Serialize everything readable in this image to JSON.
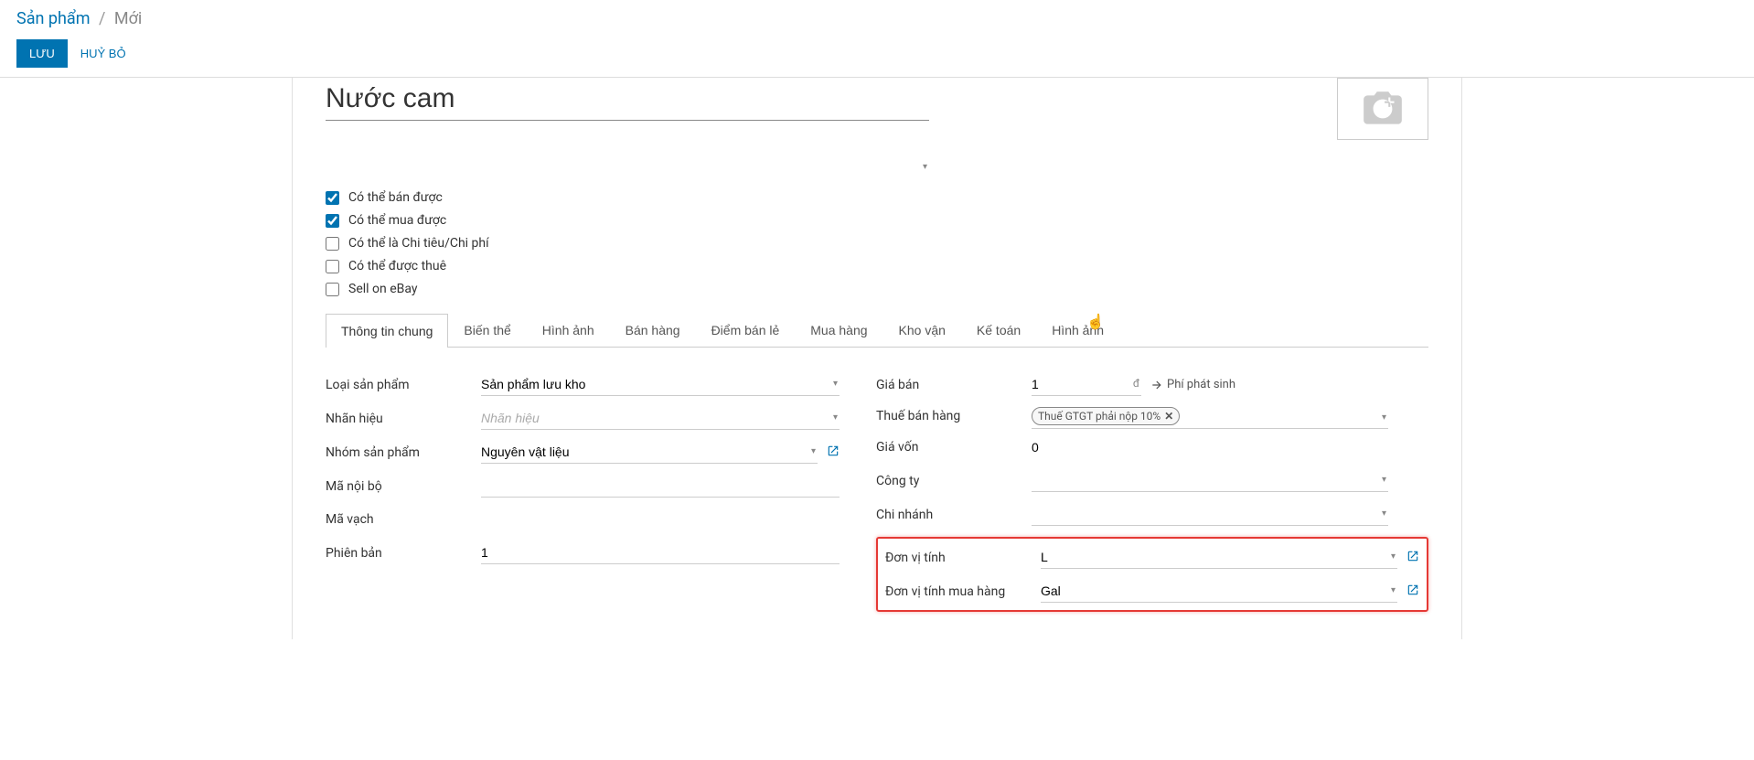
{
  "breadcrumb": {
    "root": "Sản phẩm",
    "current": "Mới"
  },
  "actions": {
    "save": "LƯU",
    "discard": "HUỶ BỎ"
  },
  "product": {
    "name": "Nước cam"
  },
  "checks": {
    "can_sell": "Có thể bán được",
    "can_buy": "Có thể mua được",
    "is_expense": "Có thể là Chi tiêu/Chi phí",
    "can_rent": "Có thể được thuê",
    "sell_ebay": "Sell on eBay"
  },
  "tabs": [
    "Thông tin chung",
    "Biến thể",
    "Hình ảnh",
    "Bán hàng",
    "Điểm bán lẻ",
    "Mua hàng",
    "Kho vận",
    "Kế toán",
    "Hình ảnh"
  ],
  "left": {
    "product_type_label": "Loại sản phẩm",
    "product_type_value": "Sản phẩm lưu kho",
    "brand_label": "Nhãn hiệu",
    "brand_placeholder": "Nhãn hiệu",
    "category_label": "Nhóm sản phẩm",
    "category_value": "Nguyên vật liệu",
    "internal_ref_label": "Mã nội bộ",
    "barcode_label": "Mã vạch",
    "version_label": "Phiên bản",
    "version_value": "1"
  },
  "right": {
    "price_label": "Giá bán",
    "price_value": "1",
    "currency": "đ",
    "extra_fee": "Phí phát sinh",
    "tax_label": "Thuế bán hàng",
    "tax_tag": "Thuế GTGT phải nộp 10%",
    "cost_label": "Giá vốn",
    "cost_value": "0",
    "company_label": "Công ty",
    "branch_label": "Chi nhánh",
    "uom_label": "Đơn vị tính",
    "uom_value": "L",
    "uom_po_label": "Đơn vị tính mua hàng",
    "uom_po_value": "Gal"
  }
}
